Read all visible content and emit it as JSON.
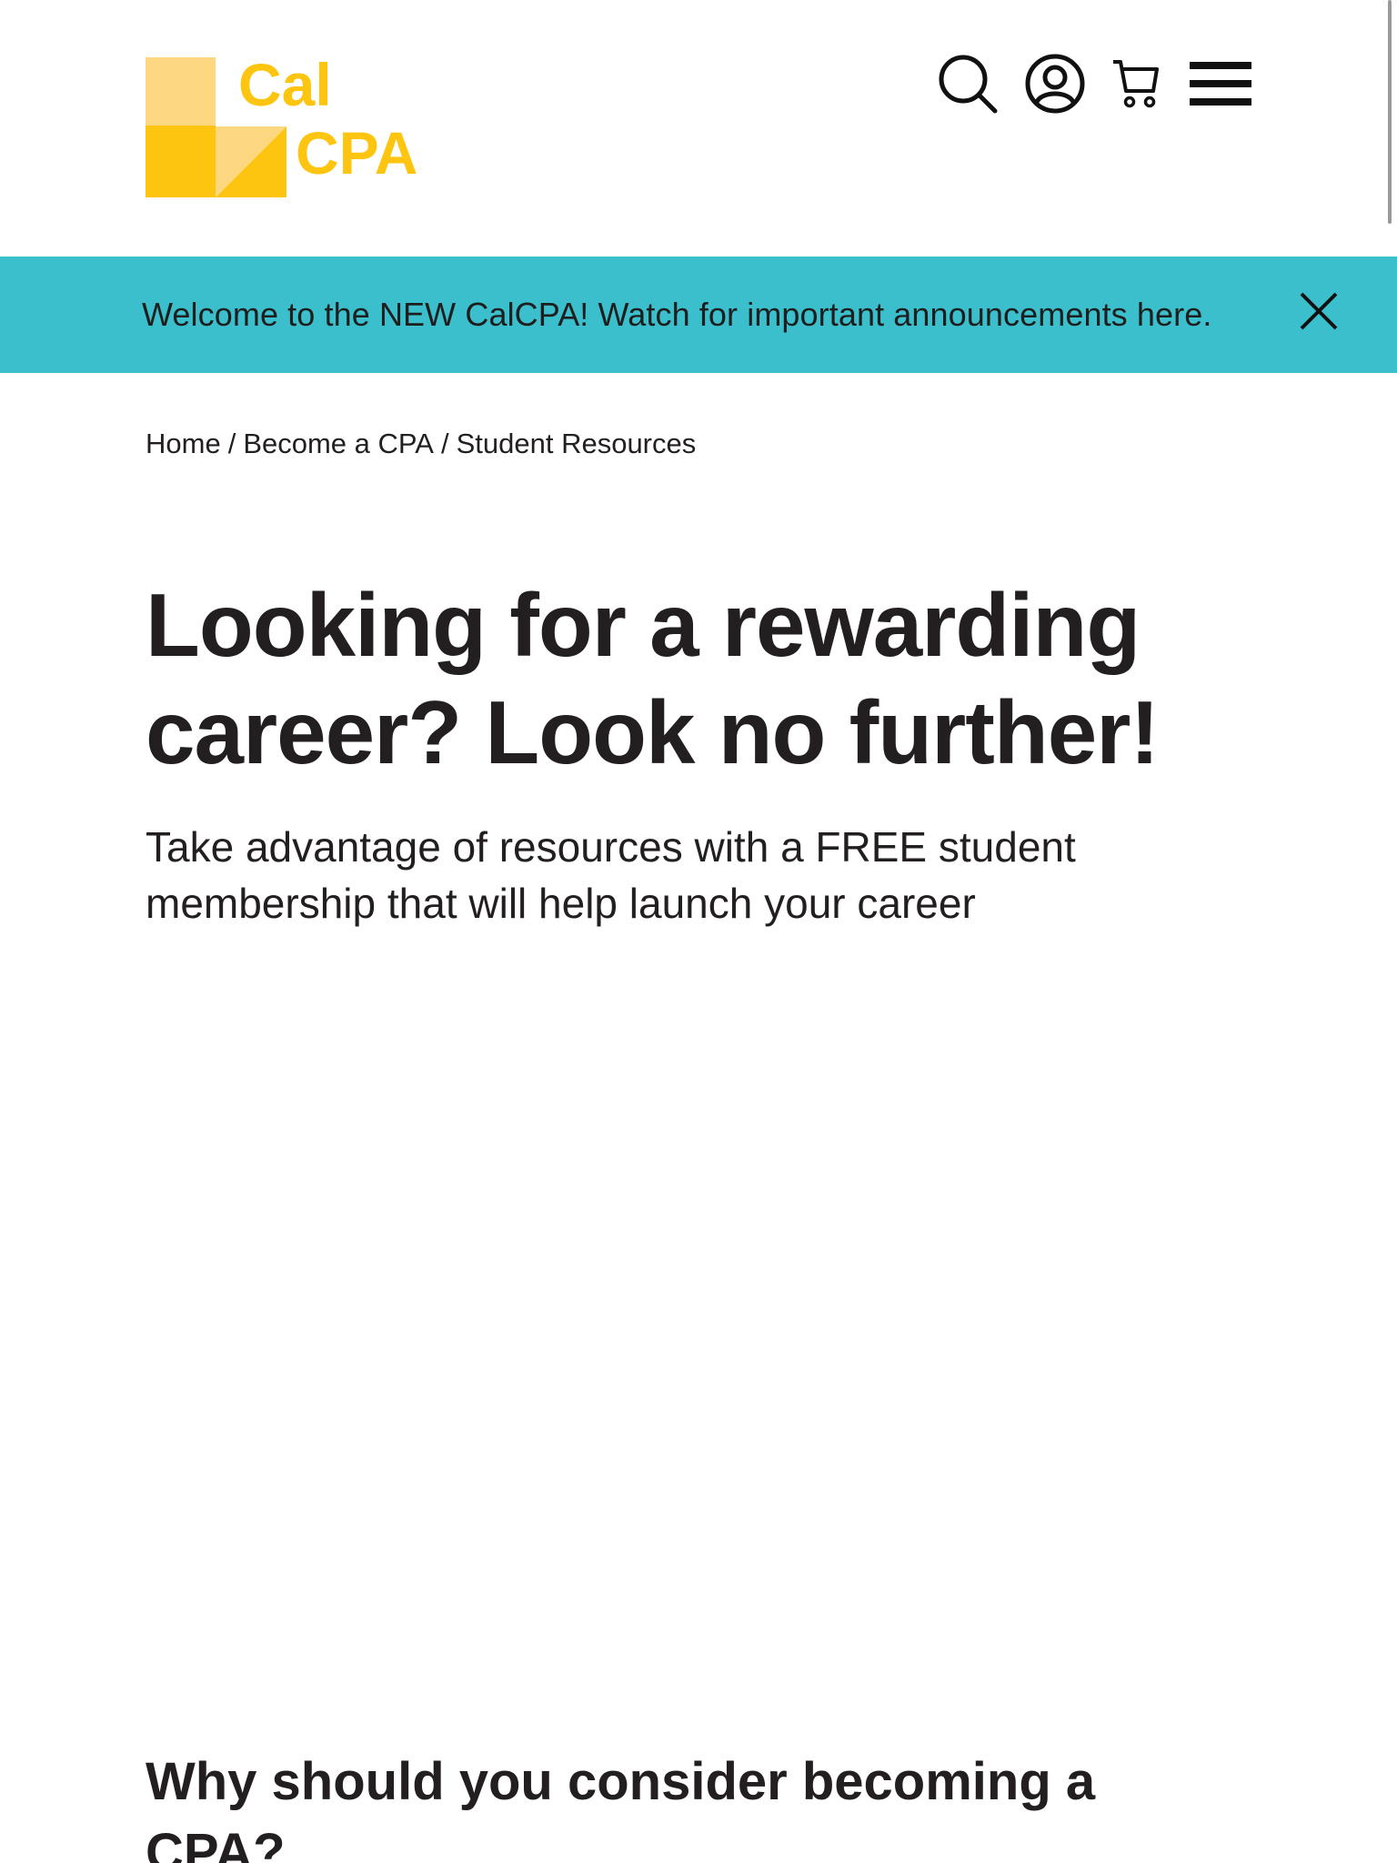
{
  "brand": {
    "logo_line1": "Cal",
    "logo_line2": "CPA",
    "logo_yellow": "#fdc50f",
    "logo_light_yellow": "#fed881"
  },
  "header_icons": [
    "search-icon",
    "account-icon",
    "cart-icon",
    "menu-icon"
  ],
  "banner": {
    "text": "Welcome to the NEW CalCPA! Watch for important announcements here.",
    "background": "#3bbfcc",
    "close_icon": "close-icon"
  },
  "breadcrumb": {
    "items": [
      "Home",
      "Become a CPA",
      "Student Resources"
    ],
    "separator": "/"
  },
  "hero": {
    "title": "Looking for a rewarding career? Look no further!",
    "subtitle": "Take advantage of resources with a FREE student membership that will help launch your career"
  },
  "section": {
    "title": "Why should you consider becoming a CPA?"
  }
}
